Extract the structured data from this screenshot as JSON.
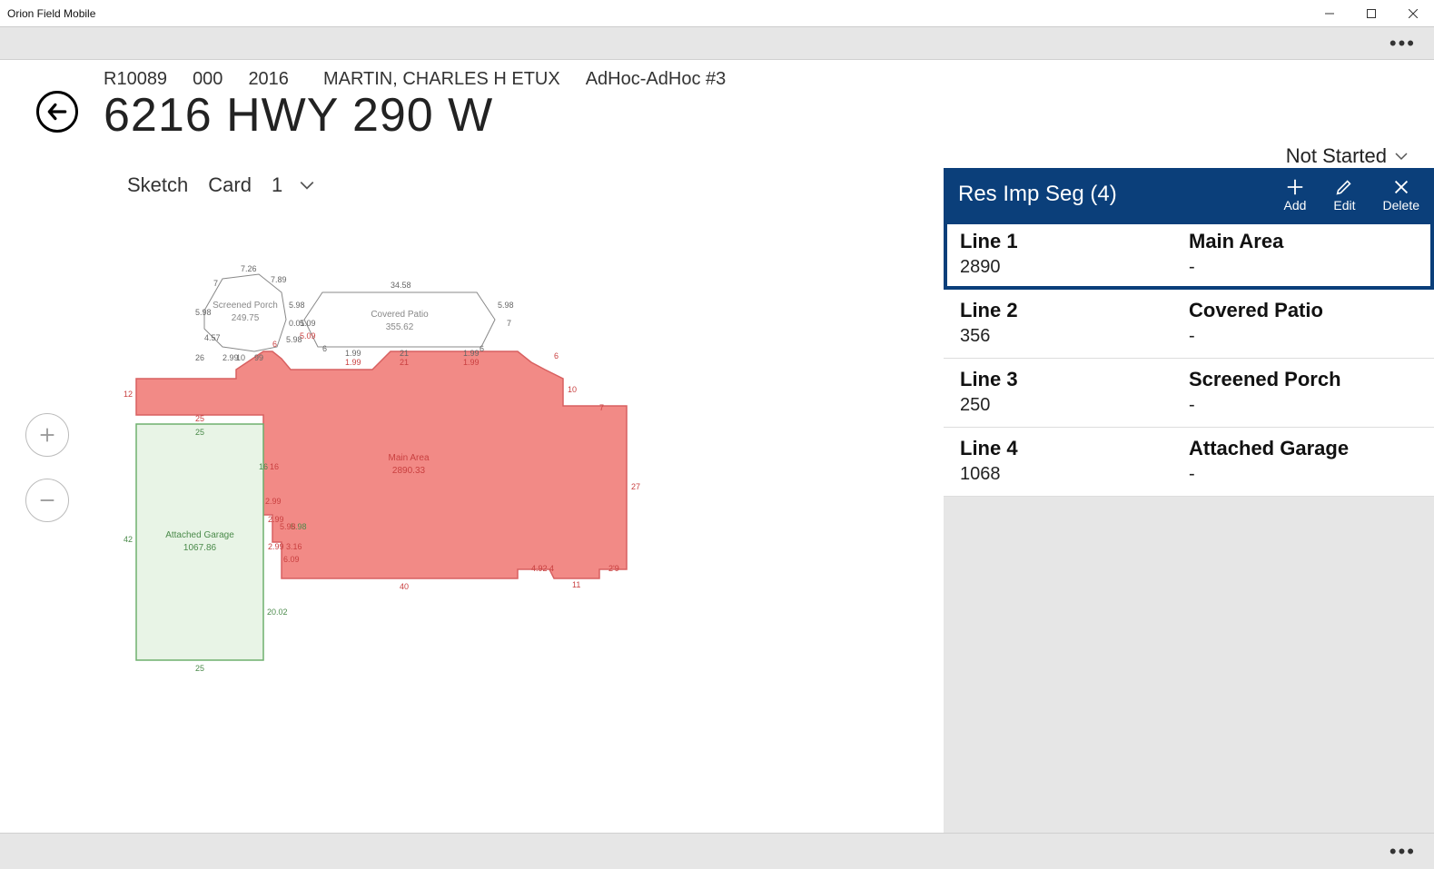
{
  "window": {
    "title": "Orion Field Mobile"
  },
  "header": {
    "parcel": "R10089",
    "mult": "000",
    "year": "2016",
    "owner": "MARTIN, CHARLES H ETUX",
    "assignment": "AdHoc-AdHoc #3",
    "address": "6216 HWY 290 W"
  },
  "status": {
    "label": "Not Started"
  },
  "sketchbar": {
    "sketch_label": "Sketch",
    "card_label": "Card",
    "card_num": "1"
  },
  "panel": {
    "title": "Res Imp Seg (4)",
    "add_label": "Add",
    "edit_label": "Edit",
    "delete_label": "Delete",
    "rows": [
      {
        "line": "Line 1",
        "type": "Main Area",
        "value": "2890",
        "extra": "-",
        "selected": true
      },
      {
        "line": "Line 2",
        "type": "Covered Patio",
        "value": "356",
        "extra": "-",
        "selected": false
      },
      {
        "line": "Line 3",
        "type": "Screened Porch",
        "value": "250",
        "extra": "-",
        "selected": false
      },
      {
        "line": "Line 4",
        "type": "Attached Garage",
        "value": "1068",
        "extra": "-",
        "selected": false
      }
    ]
  },
  "sketch": {
    "main_area": {
      "label": "Main Area",
      "area": "2890.33"
    },
    "garage": {
      "label": "Attached Garage",
      "area": "1067.86"
    },
    "porch": {
      "label": "Screened Porch",
      "area": "249.75"
    },
    "patio": {
      "label": "Covered Patio",
      "area": "355.62"
    },
    "dims": {
      "d7_26": "7.26",
      "d7a": "7",
      "d7_89": "7.89",
      "d5_98a": "5.98",
      "d5_98b": "5.98",
      "d4_57": "4.57",
      "d2_99a": "2.99",
      "d26": "26",
      "d10a": "10",
      "d99a": "99",
      "d6a": "6",
      "d0_01": "0.01",
      "d5_09a": "5.09",
      "d5_09b": "5.09",
      "d5_98c": "5.98",
      "d6b": "6",
      "d34_58": "34.58",
      "d6c": "6",
      "d5_98d": "5.98",
      "d7b": "7",
      "d1_99a": "1.99",
      "d1_99b": "1.99",
      "d21": "21",
      "d1_99c": "1.99",
      "d1_99d": "1.99",
      "d6d": "6",
      "d10b": "10",
      "d7c": "7",
      "d27": "27",
      "d2_9": "2'9",
      "d4_92": "4.92",
      "d4a": "4",
      "d11": "11",
      "d40": "40",
      "d6_09": "6.09",
      "d2_99b": "2.99",
      "d3_16": "3.16",
      "d2_99c": "2.99",
      "d5_98e": "5.98",
      "d5_98f": "5.98",
      "d2_99d": "2.99",
      "d16a": "16",
      "d16b": "16",
      "d25a": "25",
      "d25b": "25",
      "d25c": "25",
      "d12": "12",
      "d42": "42",
      "d20_02": "20.02"
    }
  }
}
